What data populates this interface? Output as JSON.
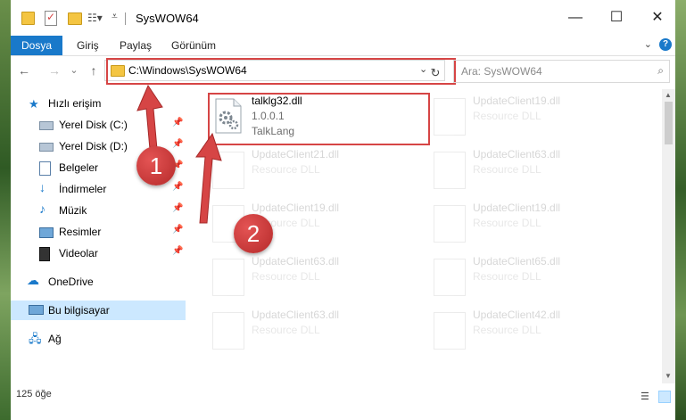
{
  "window": {
    "title": "SysWOW64"
  },
  "ribbon": {
    "tabs": [
      "Dosya",
      "Giriş",
      "Paylaş",
      "Görünüm"
    ],
    "help_label": "?"
  },
  "navbar": {
    "back": "←",
    "forward": "→",
    "recent": "⌄",
    "up": "↑",
    "path": "C:\\Windows\\SysWOW64",
    "refresh": "↻",
    "search_placeholder": "Ara: SysWOW64"
  },
  "sidebar": {
    "items": [
      {
        "label": "Hızlı erişim",
        "icon": "star-icon",
        "pinned": false
      },
      {
        "label": "Yerel Disk (C:)",
        "icon": "drive-icon",
        "pinned": true
      },
      {
        "label": "Yerel Disk (D:)",
        "icon": "drive-icon",
        "pinned": true
      },
      {
        "label": "Belgeler",
        "icon": "documents-icon",
        "pinned": true
      },
      {
        "label": "İndirmeler",
        "icon": "download-icon",
        "pinned": true
      },
      {
        "label": "Müzik",
        "icon": "music-icon",
        "pinned": true
      },
      {
        "label": "Resimler",
        "icon": "pictures-icon",
        "pinned": true
      },
      {
        "label": "Videolar",
        "icon": "videos-icon",
        "pinned": true
      },
      {
        "label": "OneDrive",
        "icon": "cloud-icon",
        "pinned": false
      },
      {
        "label": "Bu bilgisayar",
        "icon": "computer-icon",
        "pinned": false
      },
      {
        "label": "Ağ",
        "icon": "network-icon",
        "pinned": false
      }
    ],
    "pin_glyph": "📌"
  },
  "files": [
    {
      "name": "talklg32.dll",
      "line2": "1.0.0.1",
      "line3": "TalkLang"
    },
    {
      "name": "UpdateClient19.dll",
      "line2": "Resource DLL"
    },
    {
      "name": "UpdateClient21.dll",
      "line2": "Resource DLL"
    },
    {
      "name": "UpdateClient63.dll",
      "line2": "Resource DLL"
    },
    {
      "name": "UpdateClient19.dll",
      "line2": "Resource DLL"
    },
    {
      "name": "UpdateClient19.dll",
      "line2": "Resource DLL"
    },
    {
      "name": "UpdateClient63.dll",
      "line2": "Resource DLL"
    },
    {
      "name": "UpdateClient65.dll",
      "line2": "Resource DLL"
    },
    {
      "name": "UpdateClient63.dll",
      "line2": "Resource DLL"
    },
    {
      "name": "UpdateClient42.dll",
      "line2": "Resource DLL"
    }
  ],
  "status": {
    "count": "125 öğe"
  },
  "annotations": {
    "step1": "1",
    "step2": "2"
  },
  "colors": {
    "accent": "#1979ca",
    "highlight": "#d64545",
    "selected": "#cce8ff"
  }
}
